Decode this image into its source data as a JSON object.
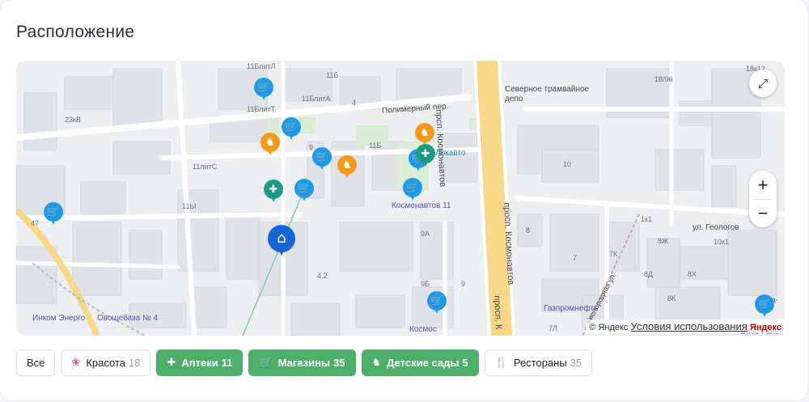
{
  "section": {
    "title": "Расположение"
  },
  "map": {
    "street_labels": {
      "polymer": "Полимерный пер.",
      "kosmonavtov_v": "прсп. Космонавтов",
      "kosmonavtov_v2": "просп. Космонавтов",
      "kosmonavtov_v3": "просп. К",
      "geologov": "ул. Геологов",
      "kislorodnaya": "Кислородная ул."
    },
    "house_numbers": [
      "11БлитЛ",
      "11Б",
      "11БлитТ",
      "11БлитА",
      "4",
      "23кВ",
      "11Б",
      "9",
      "11литС",
      "11Ы",
      "47",
      "9А",
      "4.2",
      "9Б",
      "9",
      "10",
      "8",
      "7",
      "7К",
      "8Ж",
      "8Д",
      "8Х",
      "8К",
      "7Л",
      "1к1",
      "10к1",
      "18/96",
      "18к12"
    ],
    "pois": {
      "depot": "Северное трамвайное депо",
      "lokavto": "Локавто",
      "kosmonavtov11": "Космонавтов 11",
      "gazprom": "Газпромнефть",
      "inkom": "Инком Энерго",
      "ovoshebaza": "Овощебаза № 4",
      "kosmos": "Космос",
      "drive": "Drive Fitnes",
      "partial_b": "Бэ",
      "partial_va": "ва-"
    },
    "controls": {
      "fullscreen_icon": "expand-icon",
      "zoom_in": "+",
      "zoom_out": "−"
    },
    "copyright": {
      "prefix": "© Яндекс",
      "terms": "Условия использования",
      "brand": "Яндекс"
    },
    "pin_glyphs": {
      "shop": "🛒",
      "kid": "♞",
      "pharm": "✚",
      "home": "⌂"
    },
    "colors": {
      "shop": "#1e9be8",
      "kid": "#f39a1d",
      "pharm": "#1e9a84",
      "home": "#1565d8"
    }
  },
  "filters": [
    {
      "label": "Все",
      "count": "",
      "active": false,
      "icon": ""
    },
    {
      "label": "Красота",
      "count": "18",
      "active": false,
      "icon": "lotus-icon"
    },
    {
      "label": "Аптеки",
      "count": "11",
      "active": true,
      "icon": "pharmacy-icon"
    },
    {
      "label": "Магазины",
      "count": "35",
      "active": true,
      "icon": "basket-icon"
    },
    {
      "label": "Детские сады",
      "count": "5",
      "active": true,
      "icon": "rocking-horse-icon"
    },
    {
      "label": "Рестораны",
      "count": "35",
      "active": false,
      "icon": "cutlery-icon"
    }
  ],
  "accent_green": "#4caf6a"
}
